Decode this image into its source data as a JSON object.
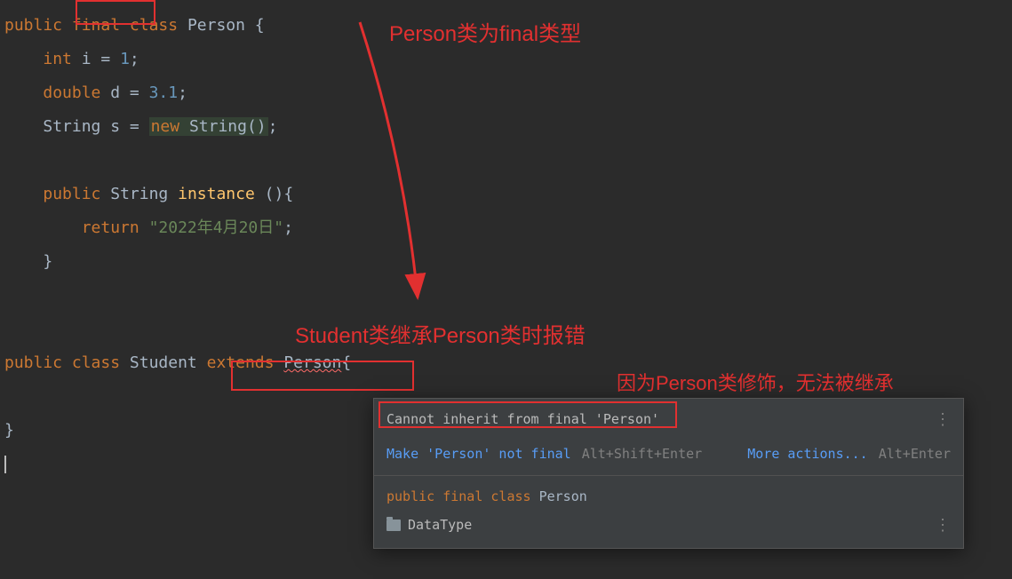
{
  "annotations": {
    "title1": "Person类为final类型",
    "title2": "Student类继承Person类时报错",
    "title3": "因为Person类修饰，无法被继承"
  },
  "code": {
    "l1": {
      "public": "public",
      "final": "final",
      "class": "class",
      "name": "Person",
      "brace": " {"
    },
    "l2": {
      "type": "int",
      "name": "i",
      "eq": " = ",
      "val": "1",
      "semi": ";"
    },
    "l3": {
      "type": "double",
      "name": "d",
      "eq": " = ",
      "val": "3.1",
      "semi": ";"
    },
    "l4": {
      "type": "String",
      "name": "s",
      "eq": " = ",
      "new": "new",
      "ctor": "String()",
      "semi": ";"
    },
    "l6": {
      "public": "public",
      "type": "String",
      "method": "instance",
      "paren": " (){"
    },
    "l7": {
      "return": "return",
      "str": "\"2022年4月20日\"",
      "semi": ";"
    },
    "l8": {
      "brace": "}"
    },
    "l10": {
      "public": "public",
      "class": "class",
      "name": "Student",
      "extends": "extends",
      "parent": "Person",
      "brace": "{"
    },
    "l12": {
      "brace": "}"
    }
  },
  "popup": {
    "error": "Cannot inherit from final 'Person'",
    "fix": "Make 'Person' not final",
    "fixShortcut": "Alt+Shift+Enter",
    "more": "More actions...",
    "moreShortcut": "Alt+Enter",
    "sig": {
      "public": "public",
      "final": "final",
      "class": "class",
      "name": "Person"
    },
    "location": "DataType"
  }
}
